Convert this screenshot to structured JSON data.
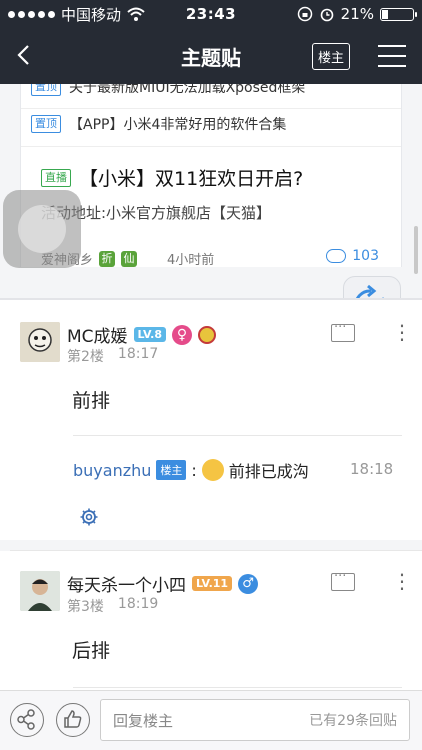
{
  "status": {
    "carrier": "中国移动",
    "time": "23:43",
    "battery_text": "21%",
    "battery_level": 0.21
  },
  "nav": {
    "title": "主题贴",
    "owner_button": "楼主"
  },
  "screenshot": {
    "pinned": [
      {
        "tag": "置顶",
        "text": "关于最新版MIUI无法加载Xposed框架"
      },
      {
        "tag": "置顶",
        "text": "【APP】小米4非常好用的软件合集"
      }
    ],
    "live": {
      "tag": "直播",
      "title": "【小米】双11狂欢日开启?",
      "subtitle": "活动地址:小米官方旗舰店【天猫】",
      "author": "爱神阁乡",
      "time": "4小时前",
      "count": "103"
    }
  },
  "replies": [
    {
      "username": "MC成媛",
      "level": "LV.8",
      "floor": "第2楼",
      "time": "18:17",
      "content": "前排",
      "subreply": {
        "user": "buyanzhu",
        "owner_tag": "楼主",
        "separator": ":",
        "text": "前排已成沟",
        "time": "18:18"
      }
    },
    {
      "username": "每天杀一个小四",
      "level": "LV.11",
      "floor": "第3楼",
      "time": "18:19",
      "content": "后排"
    }
  ],
  "bottom": {
    "reply_placeholder": "回复楼主",
    "reply_count": "已有29条回贴"
  }
}
